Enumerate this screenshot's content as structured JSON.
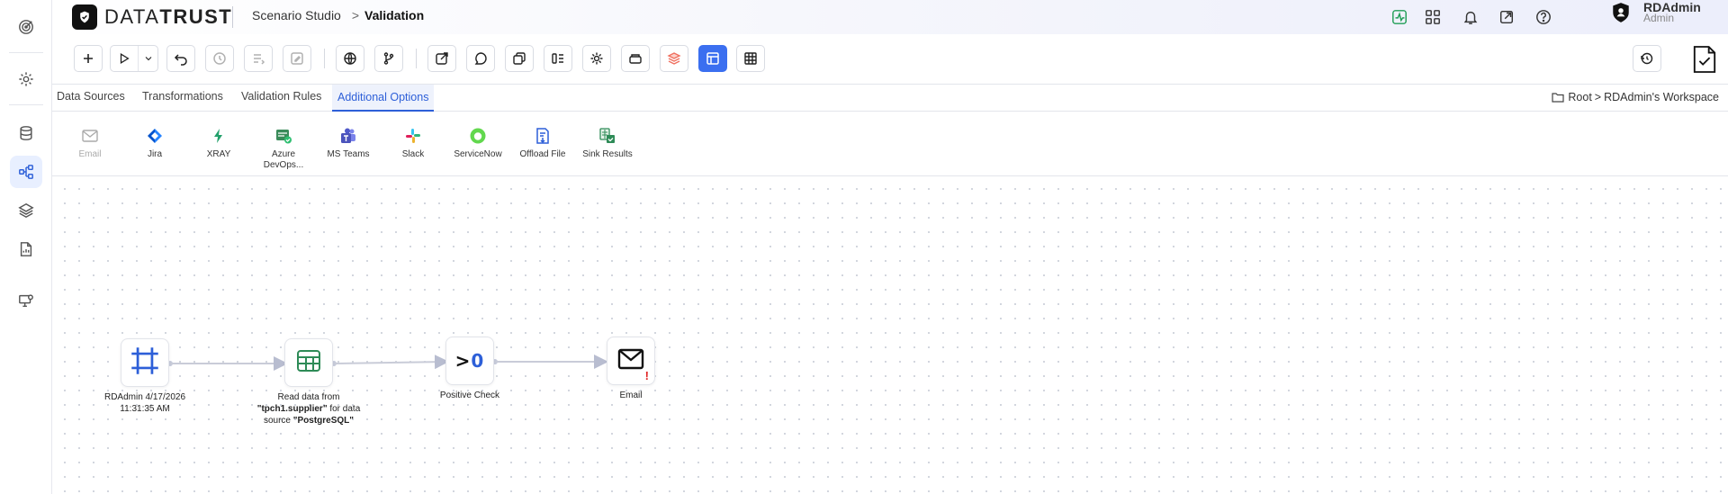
{
  "app": {
    "logo_left": "DATA",
    "logo_right": "TRUST",
    "breadcrumb": [
      "Scenario Studio",
      "Validation"
    ]
  },
  "user": {
    "name": "RDAdmin",
    "role": "Admin"
  },
  "rail": {
    "items": [
      {
        "icon": "target-icon"
      },
      {
        "icon": "gear-icon"
      },
      {
        "icon": "database-icon"
      },
      {
        "icon": "workflow-icon",
        "active": true
      },
      {
        "icon": "layers-icon"
      },
      {
        "icon": "report-icon"
      },
      {
        "icon": "monitor-settings-icon"
      }
    ]
  },
  "tabs": {
    "items": [
      "Data Sources",
      "Transformations",
      "Validation Rules",
      "Additional Options"
    ],
    "active": "Additional Options"
  },
  "workspace": {
    "root": "Root",
    "name": "RDAdmin's Workspace"
  },
  "options": [
    {
      "label": "Email",
      "disabled": true,
      "icon": "email-icon"
    },
    {
      "label": "Jira",
      "icon": "jira-icon"
    },
    {
      "label": "XRAY",
      "icon": "xray-icon"
    },
    {
      "label": "Azure DevOps...",
      "icon": "azure-devops-icon"
    },
    {
      "label": "MS Teams",
      "icon": "ms-teams-icon"
    },
    {
      "label": "Slack",
      "icon": "slack-icon"
    },
    {
      "label": "ServiceNow",
      "icon": "servicenow-icon"
    },
    {
      "label": "Offload File",
      "icon": "offload-file-icon"
    },
    {
      "label": "Sink Results",
      "icon": "sink-results-icon"
    }
  ],
  "flow": {
    "nodes": [
      {
        "id": "start",
        "label": "RDAdmin 4/17/2026 11:31:35 AM",
        "icon": "frame-icon"
      },
      {
        "id": "read",
        "label_prefix": "Read data from ",
        "table": "\"tpch1.supplier\"",
        "label_mid": " for data source ",
        "source": "\"PostgreSQL\"",
        "icon": "table-icon"
      },
      {
        "id": "check",
        "label": "Positive Check",
        "symbol": ">0",
        "icon": "greater-than-zero-icon"
      },
      {
        "id": "email",
        "label": "Email",
        "warning": "!",
        "icon": "envelope-icon"
      }
    ]
  },
  "colors": {
    "accent": "#3b6ff0",
    "active_tab": "#2d5fd8",
    "warning": "#e02424",
    "edge": "#c9ccd8"
  }
}
